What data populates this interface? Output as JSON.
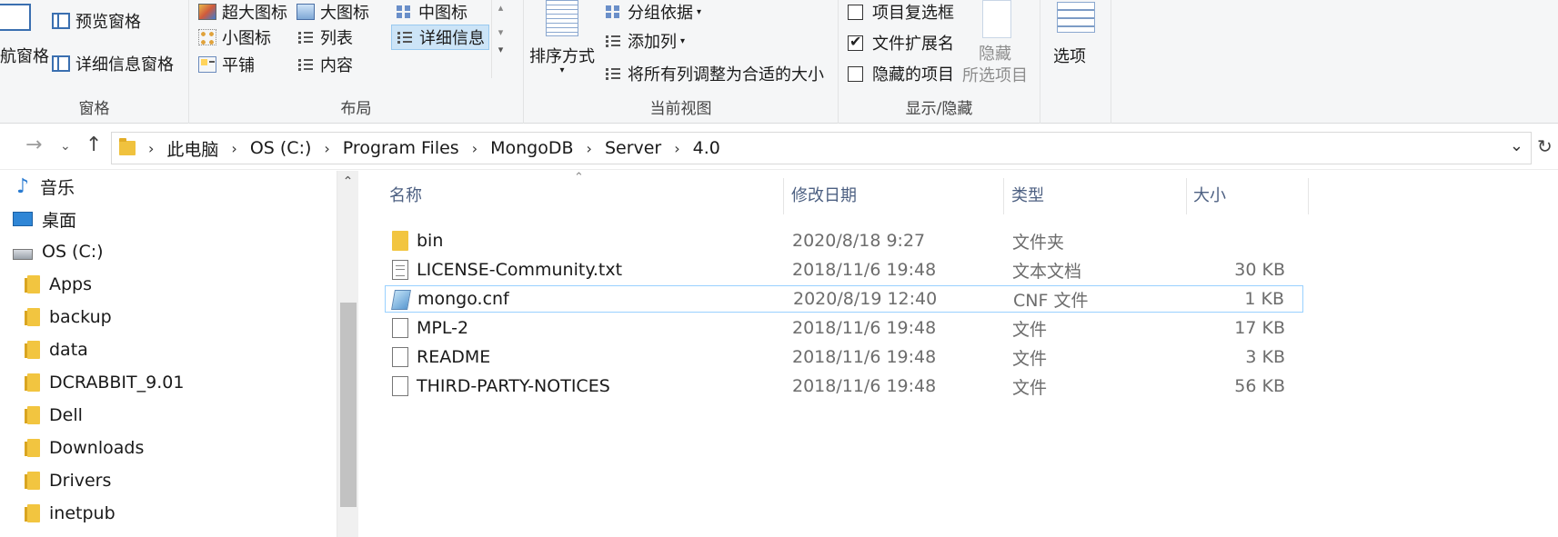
{
  "ribbon": {
    "pane_group": {
      "label": "窗格",
      "nav_pane": "航窗格",
      "preview_pane": "预览窗格",
      "details_pane": "详细信息窗格"
    },
    "layout_group": {
      "label": "布局",
      "extra_large_icons": "超大图标",
      "large_icons": "大图标",
      "medium_icons": "中图标",
      "small_icons": "小图标",
      "list": "列表",
      "details": "详细信息",
      "tiles": "平铺",
      "content": "内容"
    },
    "current_view_group": {
      "label": "当前视图",
      "sort_by": "排序方式",
      "group_by": "分组依据",
      "add_columns": "添加列",
      "size_all_columns": "将所有列调整为合适的大小"
    },
    "show_hide_group": {
      "label": "显示/隐藏",
      "item_checkboxes": "项目复选框",
      "item_checkboxes_checked": false,
      "file_name_extensions": "文件扩展名",
      "file_name_extensions_checked": true,
      "hidden_items": "隐藏的项目",
      "hidden_items_checked": false,
      "hide_selected_line1": "隐藏",
      "hide_selected_line2": "所选项目"
    },
    "options": "选项"
  },
  "address_bar": {
    "crumbs": [
      "此电脑",
      "OS (C:)",
      "Program Files",
      "MongoDB",
      "Server",
      "4.0"
    ]
  },
  "nav_pane": {
    "items": [
      {
        "label": "音乐",
        "icon": "music-icon"
      },
      {
        "label": "桌面",
        "icon": "desktop-icon"
      },
      {
        "label": "OS (C:)",
        "icon": "drive-icon"
      },
      {
        "label": "Apps",
        "icon": "folder-icon"
      },
      {
        "label": "backup",
        "icon": "folder-icon"
      },
      {
        "label": "data",
        "icon": "folder-icon"
      },
      {
        "label": "DCRABBIT_9.01",
        "icon": "folder-icon"
      },
      {
        "label": "Dell",
        "icon": "folder-icon"
      },
      {
        "label": "Downloads",
        "icon": "folder-icon"
      },
      {
        "label": "Drivers",
        "icon": "folder-icon"
      },
      {
        "label": "inetpub",
        "icon": "folder-icon"
      }
    ]
  },
  "file_list": {
    "columns": {
      "name": "名称",
      "modified": "修改日期",
      "type": "类型",
      "size": "大小"
    },
    "rows": [
      {
        "name": "bin",
        "modified": "2020/8/18 9:27",
        "type": "文件夹",
        "size": "",
        "icon": "folder-icon"
      },
      {
        "name": "LICENSE-Community.txt",
        "modified": "2018/11/6 19:48",
        "type": "文本文档",
        "size": "30 KB",
        "icon": "text-file-icon"
      },
      {
        "name": "mongo.cnf",
        "modified": "2020/8/19 12:40",
        "type": "CNF 文件",
        "size": "1 KB",
        "icon": "cnf-file-icon",
        "selected": true
      },
      {
        "name": "MPL-2",
        "modified": "2018/11/6 19:48",
        "type": "文件",
        "size": "17 KB",
        "icon": "file-icon"
      },
      {
        "name": "README",
        "modified": "2018/11/6 19:48",
        "type": "文件",
        "size": "3 KB",
        "icon": "file-icon"
      },
      {
        "name": "THIRD-PARTY-NOTICES",
        "modified": "2018/11/6 19:48",
        "type": "文件",
        "size": "56 KB",
        "icon": "file-icon"
      }
    ]
  },
  "colors": {
    "selection_fill": "#cce4f7",
    "selection_border": "#99d1ff",
    "header_text": "#4d6082"
  }
}
